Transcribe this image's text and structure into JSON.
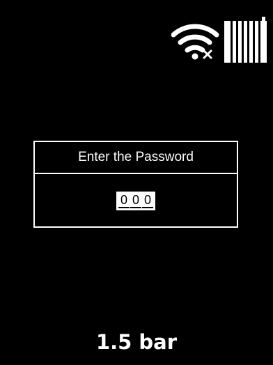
{
  "status_bar": {
    "wifi_icon": "wifi-disconnected-icon",
    "radiator_icon": "radiator-icon"
  },
  "password_dialog": {
    "title": "Enter the Password",
    "digits": [
      "0",
      "0",
      "0"
    ]
  },
  "pressure": {
    "readout": "1.5 bar"
  },
  "colors": {
    "background": "#000000",
    "foreground": "#ffffff"
  }
}
